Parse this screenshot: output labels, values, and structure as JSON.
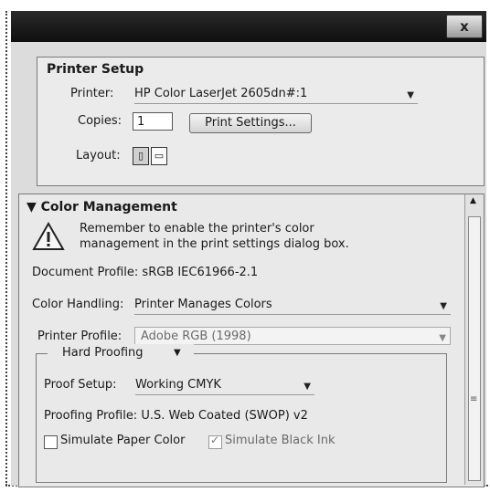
{
  "window": {
    "close_label": "x"
  },
  "printer_setup": {
    "title": "Printer Setup",
    "printer_label": "Printer:",
    "printer_value": "HP Color LaserJet 2605dn#:1",
    "copies_label": "Copies:",
    "copies_value": "1",
    "print_settings_button": "Print Settings...",
    "layout_label": "Layout:"
  },
  "color_management": {
    "title": "Color Management",
    "collapse_glyph": "▼",
    "warning_line1": "Remember to enable the printer's color",
    "warning_line2": "management in the print settings dialog box.",
    "document_profile": "Document Profile: sRGB IEC61966-2.1",
    "color_handling_label": "Color Handling:",
    "color_handling_value": "Printer Manages Colors",
    "printer_profile_label": "Printer Profile:",
    "printer_profile_value": "Adobe RGB (1998)",
    "hard_proofing": {
      "mode_value": "Hard Proofing",
      "proof_setup_label": "Proof Setup:",
      "proof_setup_value": "Working CMYK",
      "proofing_profile": "Proofing Profile: U.S. Web Coated (SWOP) v2",
      "simulate_paper_color_label": "Simulate Paper Color",
      "simulate_paper_color_checked": false,
      "simulate_black_ink_label": "Simulate Black Ink",
      "simulate_black_ink_checked": true
    }
  }
}
